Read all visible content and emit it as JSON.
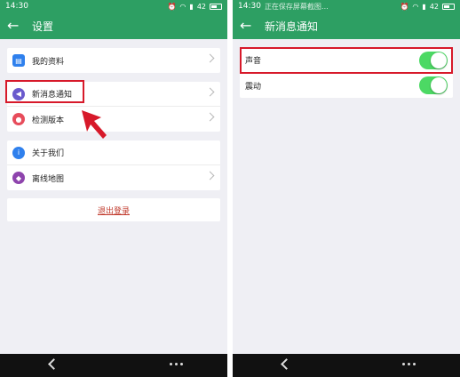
{
  "left": {
    "status": {
      "time": "14:30",
      "battery": "42"
    },
    "appbar": {
      "back_icon": "arrow-left-icon",
      "title": "设置"
    },
    "group1": [
      {
        "label": "我的资料",
        "icon": "profile-icon",
        "color": "#2f80ed"
      }
    ],
    "group2": [
      {
        "label": "新消息通知",
        "icon": "speaker-icon",
        "color": "#6a5acd"
      },
      {
        "label": "检测版本",
        "icon": "refresh-icon",
        "color": "#e74c5b"
      }
    ],
    "group3": [
      {
        "label": "关于我们",
        "icon": "info-icon",
        "color": "#2f80ed"
      },
      {
        "label": "离线地图",
        "icon": "diamond-icon",
        "color": "#8e44ad"
      }
    ],
    "logout": {
      "label": "退出登录"
    }
  },
  "right": {
    "status": {
      "time": "14:30",
      "caption": "正在保存屏幕截图…",
      "battery": "42"
    },
    "appbar": {
      "back_icon": "arrow-left-icon",
      "title": "新消息通知"
    },
    "settings": [
      {
        "label": "声音",
        "enabled": true
      },
      {
        "label": "震动",
        "enabled": true
      }
    ]
  },
  "colors": {
    "accent": "#2d9f63",
    "toggle_on": "#4cd964",
    "highlight": "#d7192a"
  }
}
